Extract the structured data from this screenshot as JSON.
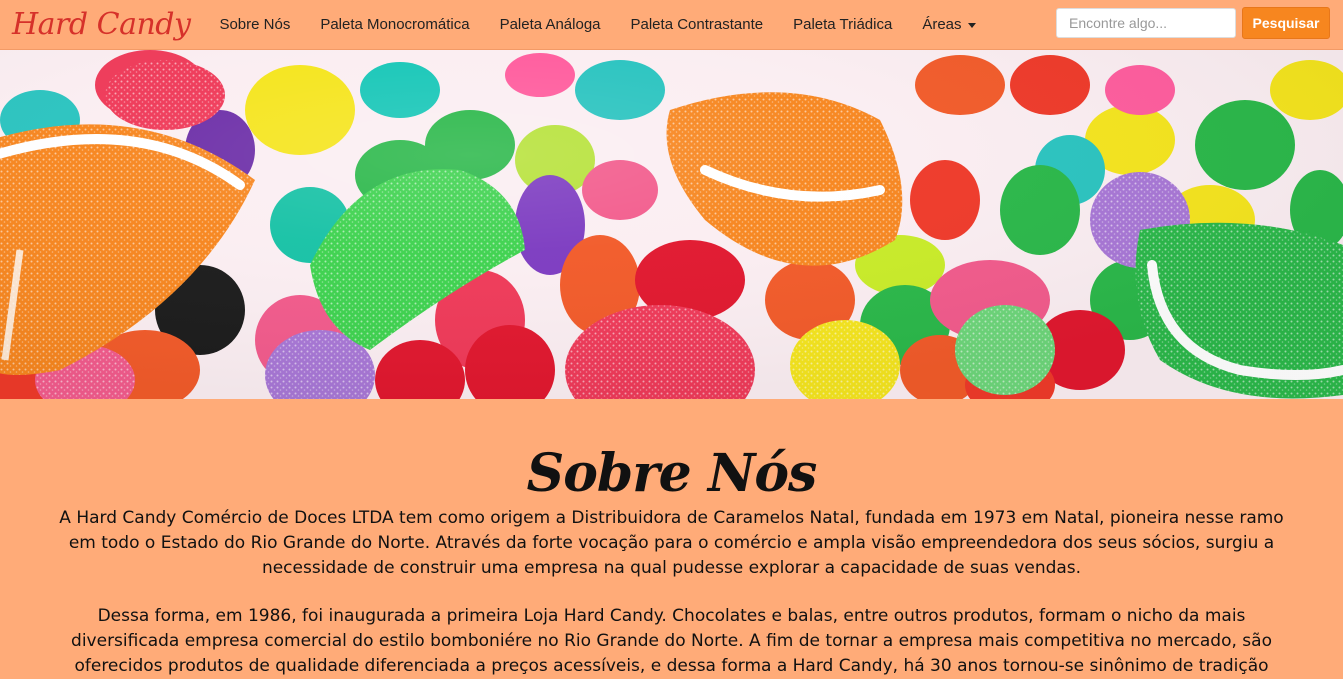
{
  "brand": {
    "name": "Hard Candy",
    "color": "#d6312a"
  },
  "nav": {
    "items": [
      {
        "label": "Sobre Nós"
      },
      {
        "label": "Paleta Monocromática"
      },
      {
        "label": "Paleta Análoga"
      },
      {
        "label": "Paleta Contrastante"
      },
      {
        "label": "Paleta Triádica"
      },
      {
        "label": "Áreas"
      }
    ]
  },
  "search": {
    "placeholder": "Encontre algo...",
    "button_label": "Pesquisar"
  },
  "colors": {
    "page_bg": "#ffab78",
    "accent": "#f7861f"
  },
  "hero": {
    "image": "colorful-candies-photo"
  },
  "about": {
    "title": "Sobre Nós",
    "paragraph_1": "A Hard Candy Comércio de Doces LTDA tem como origem a Distribuidora de Caramelos Natal, fundada em 1973 em Natal, pioneira nesse ramo em todo o Estado do Rio Grande do Norte. Através da forte vocação para o comércio e ampla visão empreendedora dos seus sócios, surgiu a necessidade de construir uma empresa na qual pudesse explorar a capacidade de suas vendas.",
    "paragraph_2": "Dessa forma, em 1986, foi inaugurada a primeira Loja Hard Candy. Chocolates e balas, entre outros produtos, formam o nicho da mais diversificada empresa comercial do estilo bomboniére no Rio Grande do Norte. A fim de tornar a empresa mais competitiva no mercado, são oferecidos produtos de qualidade diferenciada a preços acessíveis, e dessa forma a Hard Candy, há 30 anos tornou-se sinônimo de tradição"
  }
}
